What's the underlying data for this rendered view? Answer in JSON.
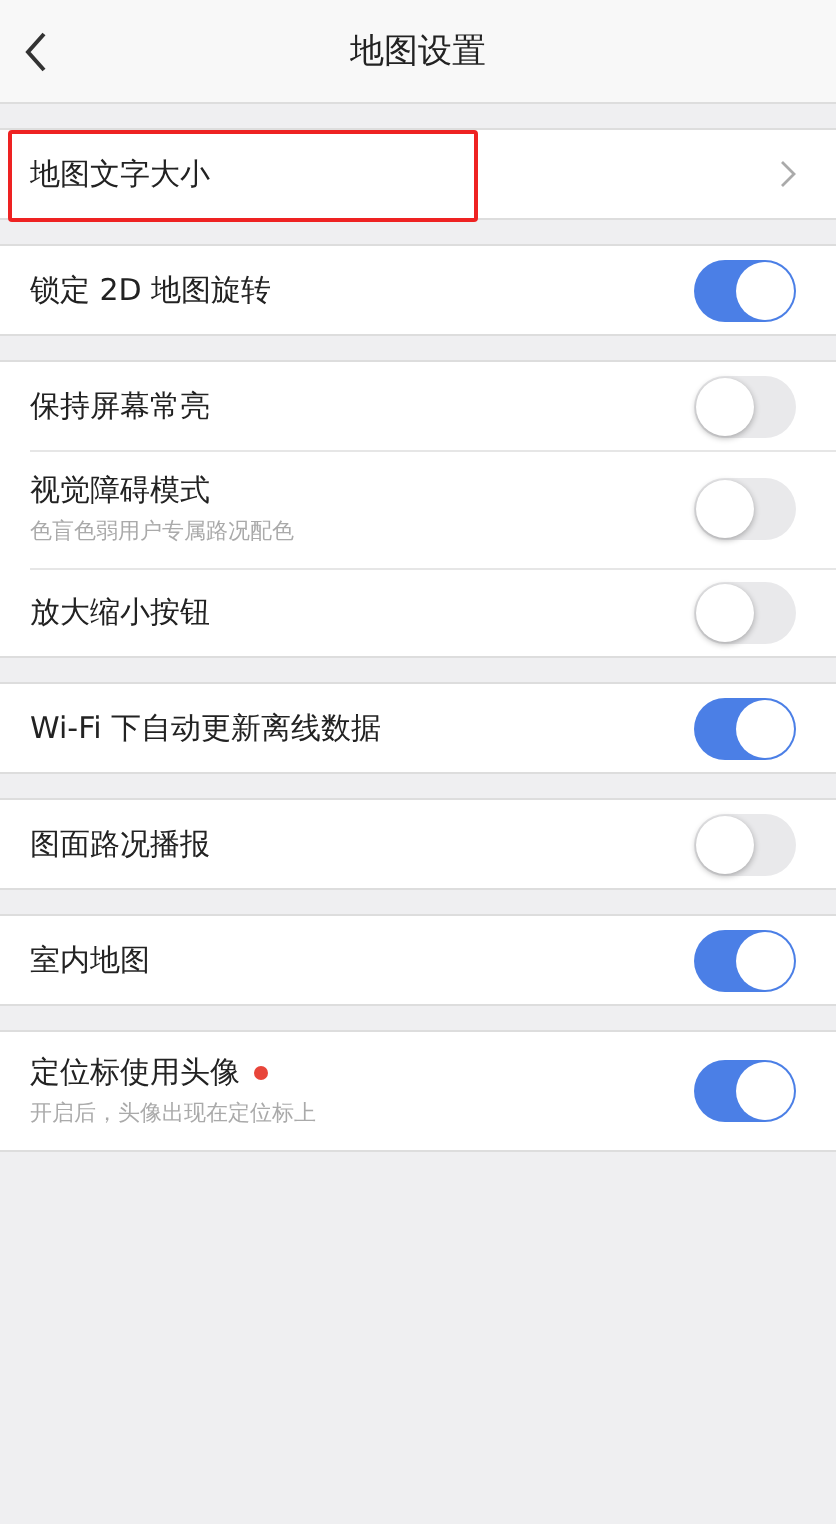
{
  "header": {
    "title": "地图设置"
  },
  "groups": [
    {
      "items": [
        {
          "kind": "link",
          "label": "地图文字大小",
          "highlighted": true,
          "dot": false
        }
      ]
    },
    {
      "items": [
        {
          "kind": "switch",
          "label": "锁定 2D 地图旋转",
          "on": true,
          "highlighted": false,
          "dot": false
        }
      ]
    },
    {
      "items": [
        {
          "kind": "switch",
          "label": "保持屏幕常亮",
          "on": false,
          "highlighted": false,
          "dot": false
        },
        {
          "kind": "switch",
          "label": "视觉障碍模式",
          "subtitle": "色盲色弱用户专属路况配色",
          "on": false,
          "highlighted": false,
          "dot": false
        },
        {
          "kind": "switch",
          "label": "放大缩小按钮",
          "on": false,
          "highlighted": false,
          "dot": false
        }
      ]
    },
    {
      "items": [
        {
          "kind": "switch",
          "label": "Wi-Fi 下自动更新离线数据",
          "on": true,
          "highlighted": false,
          "dot": false
        }
      ]
    },
    {
      "items": [
        {
          "kind": "switch",
          "label": "图面路况播报",
          "on": false,
          "highlighted": false,
          "dot": false
        }
      ]
    },
    {
      "items": [
        {
          "kind": "switch",
          "label": "室内地图",
          "on": true,
          "highlighted": false,
          "dot": false
        }
      ]
    },
    {
      "items": [
        {
          "kind": "switch",
          "label": "定位标使用头像",
          "subtitle": "开启后，头像出现在定位标上",
          "on": true,
          "highlighted": false,
          "dot": true
        }
      ]
    }
  ]
}
